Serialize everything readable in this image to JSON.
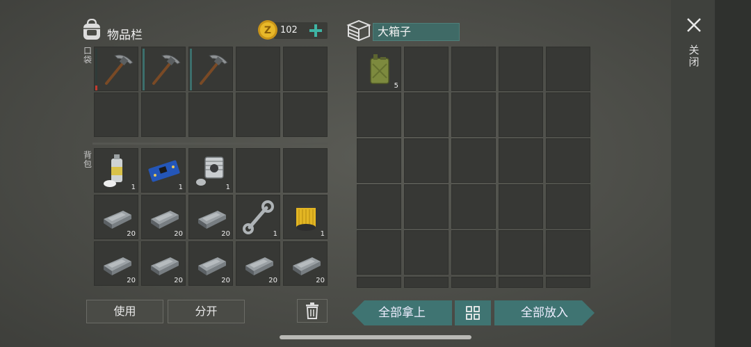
{
  "inventory": {
    "title": "物品栏",
    "coins": "102",
    "pocket_label": "口袋",
    "backpack_label": "背包",
    "pocket_slots": [
      {
        "icon": "pickaxe-icon",
        "qty": "",
        "durability": "low"
      },
      {
        "icon": "pickaxe-icon",
        "qty": "",
        "durability": "full"
      },
      {
        "icon": "pickaxe-icon",
        "qty": "",
        "durability": "full"
      },
      {
        "icon": "",
        "qty": ""
      },
      {
        "icon": "",
        "qty": ""
      },
      {
        "icon": "",
        "qty": ""
      },
      {
        "icon": "",
        "qty": ""
      },
      {
        "icon": "",
        "qty": ""
      },
      {
        "icon": "",
        "qty": ""
      },
      {
        "icon": "",
        "qty": ""
      }
    ],
    "backpack_slots": [
      {
        "icon": "spray-can-icon",
        "qty": "1"
      },
      {
        "icon": "circuit-board-icon",
        "qty": "1"
      },
      {
        "icon": "engine-cylinder-icon",
        "qty": "1"
      },
      {
        "icon": "",
        "qty": ""
      },
      {
        "icon": "",
        "qty": ""
      },
      {
        "icon": "iron-ingot-icon",
        "qty": "20"
      },
      {
        "icon": "iron-ingot-icon",
        "qty": "20"
      },
      {
        "icon": "iron-ingot-icon",
        "qty": "20"
      },
      {
        "icon": "wrench-icon",
        "qty": "1"
      },
      {
        "icon": "oil-filter-icon",
        "qty": "1"
      },
      {
        "icon": "iron-ingot-icon",
        "qty": "20"
      },
      {
        "icon": "iron-ingot-icon",
        "qty": "20"
      },
      {
        "icon": "iron-ingot-icon",
        "qty": "20"
      },
      {
        "icon": "iron-ingot-icon",
        "qty": "20"
      },
      {
        "icon": "iron-ingot-icon",
        "qty": "20"
      }
    ],
    "use_button": "使用",
    "split_button": "分开"
  },
  "chest": {
    "name": "大箱子",
    "slots": [
      {
        "icon": "jerry-can-icon",
        "qty": "5"
      }
    ],
    "take_all_button": "全部拿上",
    "put_all_button": "全部放入"
  },
  "close_label": "关闭",
  "colors": {
    "accent": "#3f7472",
    "coin": "#d9a520"
  }
}
